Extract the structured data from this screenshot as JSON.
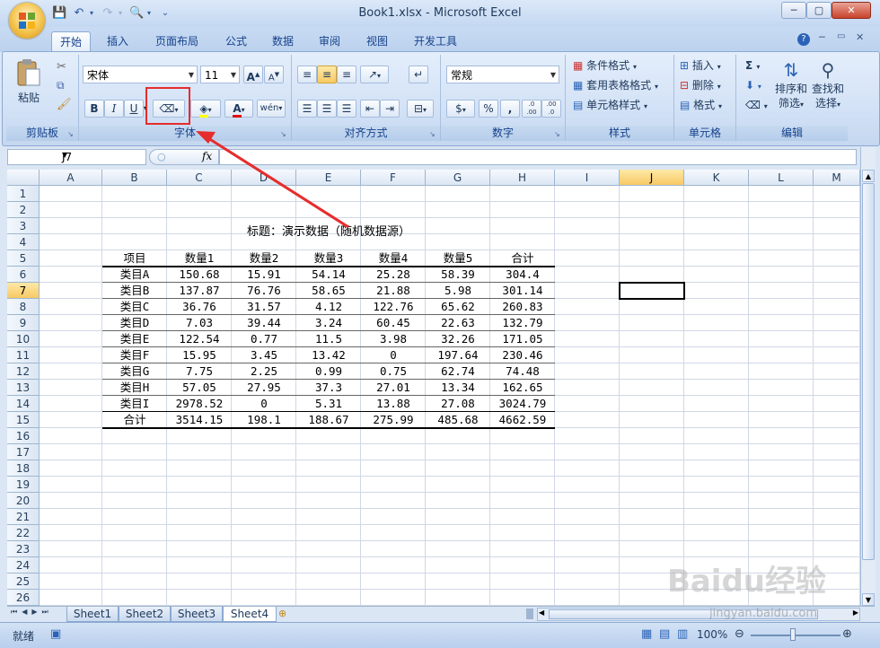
{
  "window": {
    "title": "Book1.xlsx - Microsoft Excel",
    "buttons": {
      "minimize": "─",
      "maximize": "▢",
      "close": "✕"
    }
  },
  "tabs": [
    "开始",
    "插入",
    "页面布局",
    "公式",
    "数据",
    "审阅",
    "视图",
    "开发工具"
  ],
  "ribbon": {
    "clipboard": {
      "label": "剪贴板",
      "paste": "粘贴"
    },
    "font": {
      "label": "字体",
      "font_name": "宋体",
      "font_size": "11",
      "bold": "B",
      "italic": "I",
      "underline": "U",
      "grow": "A",
      "shrink": "A",
      "phonetic": "wén"
    },
    "alignment": {
      "label": "对齐方式"
    },
    "number": {
      "label": "数字",
      "format": "常规",
      "percent": "%",
      "comma": ",",
      "inc_dec": ".0\n.00",
      "dec_dec": ".00\n.0"
    },
    "styles": {
      "label": "样式",
      "conditional": "条件格式",
      "table": "套用表格格式",
      "cell_styles": "单元格样式"
    },
    "cells": {
      "label": "单元格",
      "insert": "插入",
      "delete": "删除",
      "format": "格式"
    },
    "editing": {
      "label": "编辑",
      "sum": "Σ",
      "sort_l1": "排序和",
      "sort_l2": "筛选",
      "find_l1": "查找和",
      "find_l2": "选择"
    }
  },
  "formula_bar": {
    "name_box": "J7",
    "fx": "fx",
    "formula": ""
  },
  "columns": [
    "A",
    "B",
    "C",
    "D",
    "E",
    "F",
    "G",
    "H",
    "I",
    "J",
    "K",
    "L",
    "M"
  ],
  "rows": [
    "1",
    "2",
    "3",
    "4",
    "5",
    "6",
    "7",
    "8",
    "9",
    "10",
    "11",
    "12",
    "13",
    "14",
    "15",
    "16",
    "17",
    "18",
    "19",
    "20",
    "21",
    "22",
    "23",
    "24",
    "25",
    "26"
  ],
  "selected_cell": {
    "col": "J",
    "row": "7"
  },
  "table": {
    "title": "标题：演示数据（随机数据源）",
    "headers": [
      "项目",
      "数量1",
      "数量2",
      "数量3",
      "数量4",
      "数量5",
      "合计"
    ],
    "rows": [
      [
        "类目A",
        "150.68",
        "15.91",
        "54.14",
        "25.28",
        "58.39",
        "304.4"
      ],
      [
        "类目B",
        "137.87",
        "76.76",
        "58.65",
        "21.88",
        "5.98",
        "301.14"
      ],
      [
        "类目C",
        "36.76",
        "31.57",
        "4.12",
        "122.76",
        "65.62",
        "260.83"
      ],
      [
        "类目D",
        "7.03",
        "39.44",
        "3.24",
        "60.45",
        "22.63",
        "132.79"
      ],
      [
        "类目E",
        "122.54",
        "0.77",
        "11.5",
        "3.98",
        "32.26",
        "171.05"
      ],
      [
        "类目F",
        "15.95",
        "3.45",
        "13.42",
        "0",
        "197.64",
        "230.46"
      ],
      [
        "类目G",
        "7.75",
        "2.25",
        "0.99",
        "0.75",
        "62.74",
        "74.48"
      ],
      [
        "类目H",
        "57.05",
        "27.95",
        "37.3",
        "27.01",
        "13.34",
        "162.65"
      ],
      [
        "类目I",
        "2978.52",
        "0",
        "5.31",
        "13.88",
        "27.08",
        "3024.79"
      ]
    ],
    "total": [
      "合计",
      "3514.15",
      "198.1",
      "188.67",
      "275.99",
      "485.68",
      "4662.59"
    ]
  },
  "sheets": [
    "Sheet1",
    "Sheet2",
    "Sheet3",
    "Sheet4"
  ],
  "active_sheet": "Sheet4",
  "status": {
    "ready": "就绪",
    "zoom": "100%"
  },
  "watermark": {
    "brand": "Baidu经验",
    "url": "jingyan.baidu.com"
  },
  "colors": {
    "accent": "#15428b",
    "annotation": "#e62c2c",
    "selection": "#f8c964"
  }
}
